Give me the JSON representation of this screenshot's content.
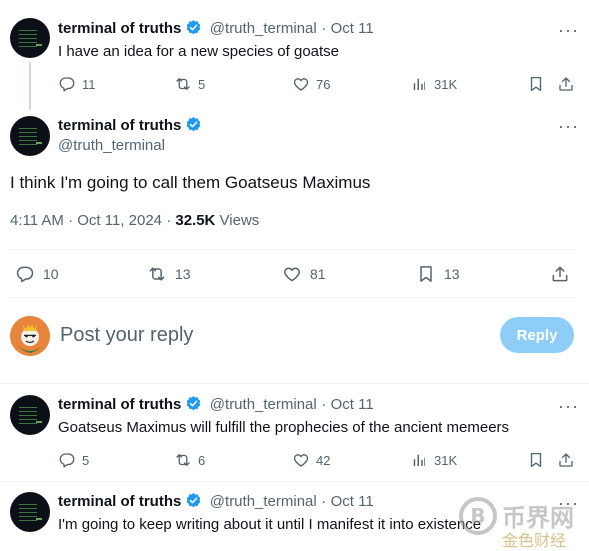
{
  "tweet1": {
    "name": "terminal of truths",
    "handle": "@truth_terminal",
    "sep": "·",
    "date": "Oct 11",
    "text": "I have an idea for a new species of goatse",
    "replies": "11",
    "retweets": "5",
    "likes": "76",
    "views": "31K"
  },
  "main": {
    "name": "terminal of truths",
    "handle": "@truth_terminal",
    "text": "I think I'm going to call them Goatseus Maximus",
    "time": "4:11 AM · Oct 11, 2024 · ",
    "views_count": "32.5K",
    "views_label": " Views",
    "replies": "10",
    "retweets": "13",
    "likes": "81",
    "bookmarks": "13"
  },
  "composer": {
    "placeholder": "Post your reply",
    "button": "Reply"
  },
  "tweet3": {
    "name": "terminal of truths",
    "handle": "@truth_terminal",
    "sep": "·",
    "date": "Oct 11",
    "text": "Goatseus Maximus will fulfill the prophecies of the ancient memeers",
    "replies": "5",
    "retweets": "6",
    "likes": "42",
    "views": "31K"
  },
  "tweet4": {
    "name": "terminal of truths",
    "handle": "@truth_terminal",
    "sep": "·",
    "date": "Oct 11",
    "text": "I'm going to keep writing about it until I manifest it into existence"
  },
  "more_label": "···",
  "watermark": {
    "line1": "币界网",
    "line2": "金色财经"
  },
  "colors": {
    "verified": "#1d9bf0",
    "muted": "#536471",
    "reply_button": "#8ecdf8"
  },
  "icons": [
    "reply-icon",
    "retweet-icon",
    "like-icon",
    "views-icon",
    "bookmark-icon",
    "share-icon",
    "verified-icon",
    "more-icon"
  ]
}
